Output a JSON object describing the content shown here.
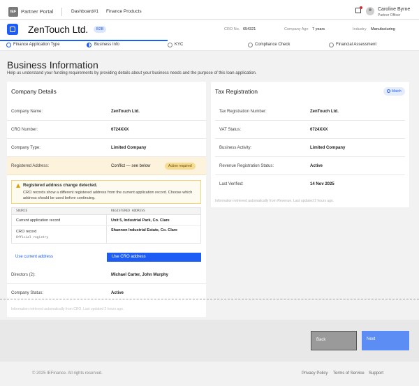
{
  "nav": {
    "logo": "IEF",
    "portal": "Partner Portal",
    "links": [
      "Dashboard#1",
      "Finance Products"
    ],
    "user_name": "Caroline Byrne",
    "user_role": "Partner Officer"
  },
  "company": {
    "name": "ZenTouch Ltd.",
    "badge": "B2B",
    "cro_label": "CRO No.",
    "cro_value": "654321",
    "age_label": "Company Age",
    "age_value": "7 years",
    "industry_label": "Industry",
    "industry_value": "Manufacturing"
  },
  "steps": [
    "Finance Application Type",
    "Business Info",
    "KYC",
    "Compliance Check",
    "Financial Assessment"
  ],
  "page": {
    "title": "Business Information",
    "subtitle": "Help us understand your funding requirements by providing details about your business needs and the purpose of this loan application."
  },
  "company_details": {
    "title": "Company Details",
    "rows": [
      {
        "label": "Company Name:",
        "value": "ZenTouch Ltd."
      },
      {
        "label": "CRO Number:",
        "value": "6724XXX"
      },
      {
        "label": "Company Type:",
        "value": "Limited Company"
      }
    ],
    "conflict_label": "Registered Address:",
    "conflict_value": "Conflict — see below",
    "action_badge": "Action required",
    "alert_title": "Registered address change detected.",
    "alert_body": "CRO records show a different registered address from the current application record. Choose which address should be used before continuing.",
    "table_headers": [
      "SOURCE",
      "REGISTERED ADDRESS"
    ],
    "table_rows": [
      {
        "source": "Current application record",
        "sub": "",
        "address": "Unit 5, Industrial Park, Co. Clare"
      },
      {
        "source": "CRO record",
        "sub": "Official registry",
        "address": "Shannon Industrial Estate, Co. Clare"
      }
    ],
    "use_current": "Use current address",
    "use_cro": "Use CRO address",
    "rows_after": [
      {
        "label": "Directors (2):",
        "value": "Michael Carter, John Murphy"
      },
      {
        "label": "Company Status:",
        "value": "Active"
      }
    ],
    "footnote": "Information retrieved automatically from CRO. Last updated 2 hours ago."
  },
  "tax": {
    "title": "Tax Registration",
    "match": "Match",
    "rows": [
      {
        "label": "Tax Registration Number:",
        "value": "ZenTouch Ltd."
      },
      {
        "label": "VAT Status:",
        "value": "6724XXX"
      },
      {
        "label": "Business Activity:",
        "value": "Limited Company"
      },
      {
        "label": "Revenue Registration Status:",
        "value": "Active"
      },
      {
        "label": "Last Verified:",
        "value": "14 Nov 2025"
      }
    ],
    "footnote": "Information retrieved automatically from Revenue. Last updated 2 hours ago."
  },
  "buttons": {
    "back": "Back",
    "next": "Next"
  },
  "footer": {
    "copyright": "© 2025 IEFinance. All rights reserved.",
    "links": [
      "Privacy Policy",
      "Terms of Service",
      "Support"
    ]
  }
}
